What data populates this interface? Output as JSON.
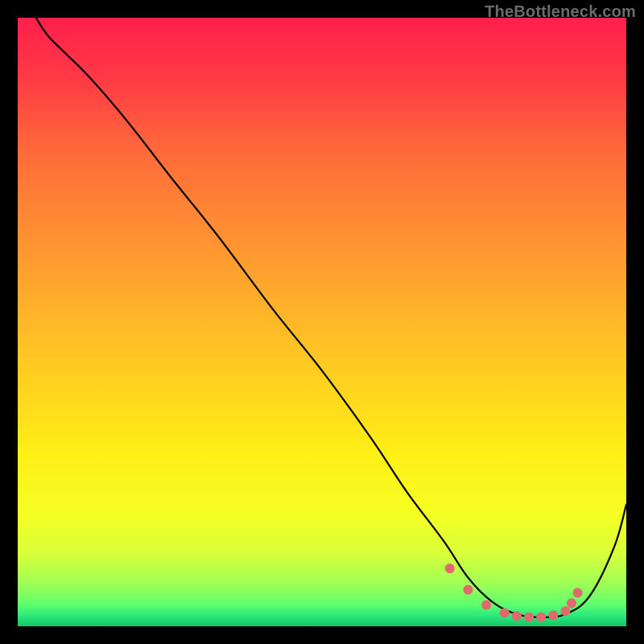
{
  "watermark": "TheBottleneck.com",
  "gradient": {
    "stops": [
      {
        "offset": 0.0,
        "color": "#ff1f4b"
      },
      {
        "offset": 0.1,
        "color": "#ff3a45"
      },
      {
        "offset": 0.22,
        "color": "#ff6a3a"
      },
      {
        "offset": 0.35,
        "color": "#ff8e33"
      },
      {
        "offset": 0.48,
        "color": "#ffb22a"
      },
      {
        "offset": 0.6,
        "color": "#ffd21f"
      },
      {
        "offset": 0.72,
        "color": "#fff016"
      },
      {
        "offset": 0.82,
        "color": "#f4ff24"
      },
      {
        "offset": 0.88,
        "color": "#d9ff3a"
      },
      {
        "offset": 0.93,
        "color": "#9fff55"
      },
      {
        "offset": 0.965,
        "color": "#5cff70"
      },
      {
        "offset": 0.985,
        "color": "#26e67a"
      },
      {
        "offset": 1.0,
        "color": "#14c564"
      }
    ]
  },
  "chart_data": {
    "type": "line",
    "title": "",
    "xlabel": "",
    "ylabel": "",
    "xlim": [
      0,
      100
    ],
    "ylim": [
      0,
      100
    ],
    "series": [
      {
        "name": "bottleneck-curve",
        "x": [
          3,
          5,
          8,
          12,
          18,
          25,
          33,
          42,
          50,
          58,
          64,
          70,
          74,
          78,
          82,
          86,
          90,
          94,
          98,
          100
        ],
        "y": [
          100,
          97,
          94,
          90,
          83,
          74,
          64,
          52,
          42,
          31,
          22,
          14,
          8,
          4,
          2,
          1.5,
          2,
          5,
          13,
          20
        ]
      }
    ],
    "markers": {
      "name": "optimal-range-dots",
      "color": "#e06a6c",
      "x": [
        71,
        74,
        77,
        80,
        82,
        84,
        86,
        88,
        90,
        91,
        92
      ],
      "y": [
        9.5,
        6.0,
        3.5,
        2.2,
        1.7,
        1.5,
        1.5,
        1.8,
        2.5,
        3.8,
        5.5
      ]
    }
  }
}
